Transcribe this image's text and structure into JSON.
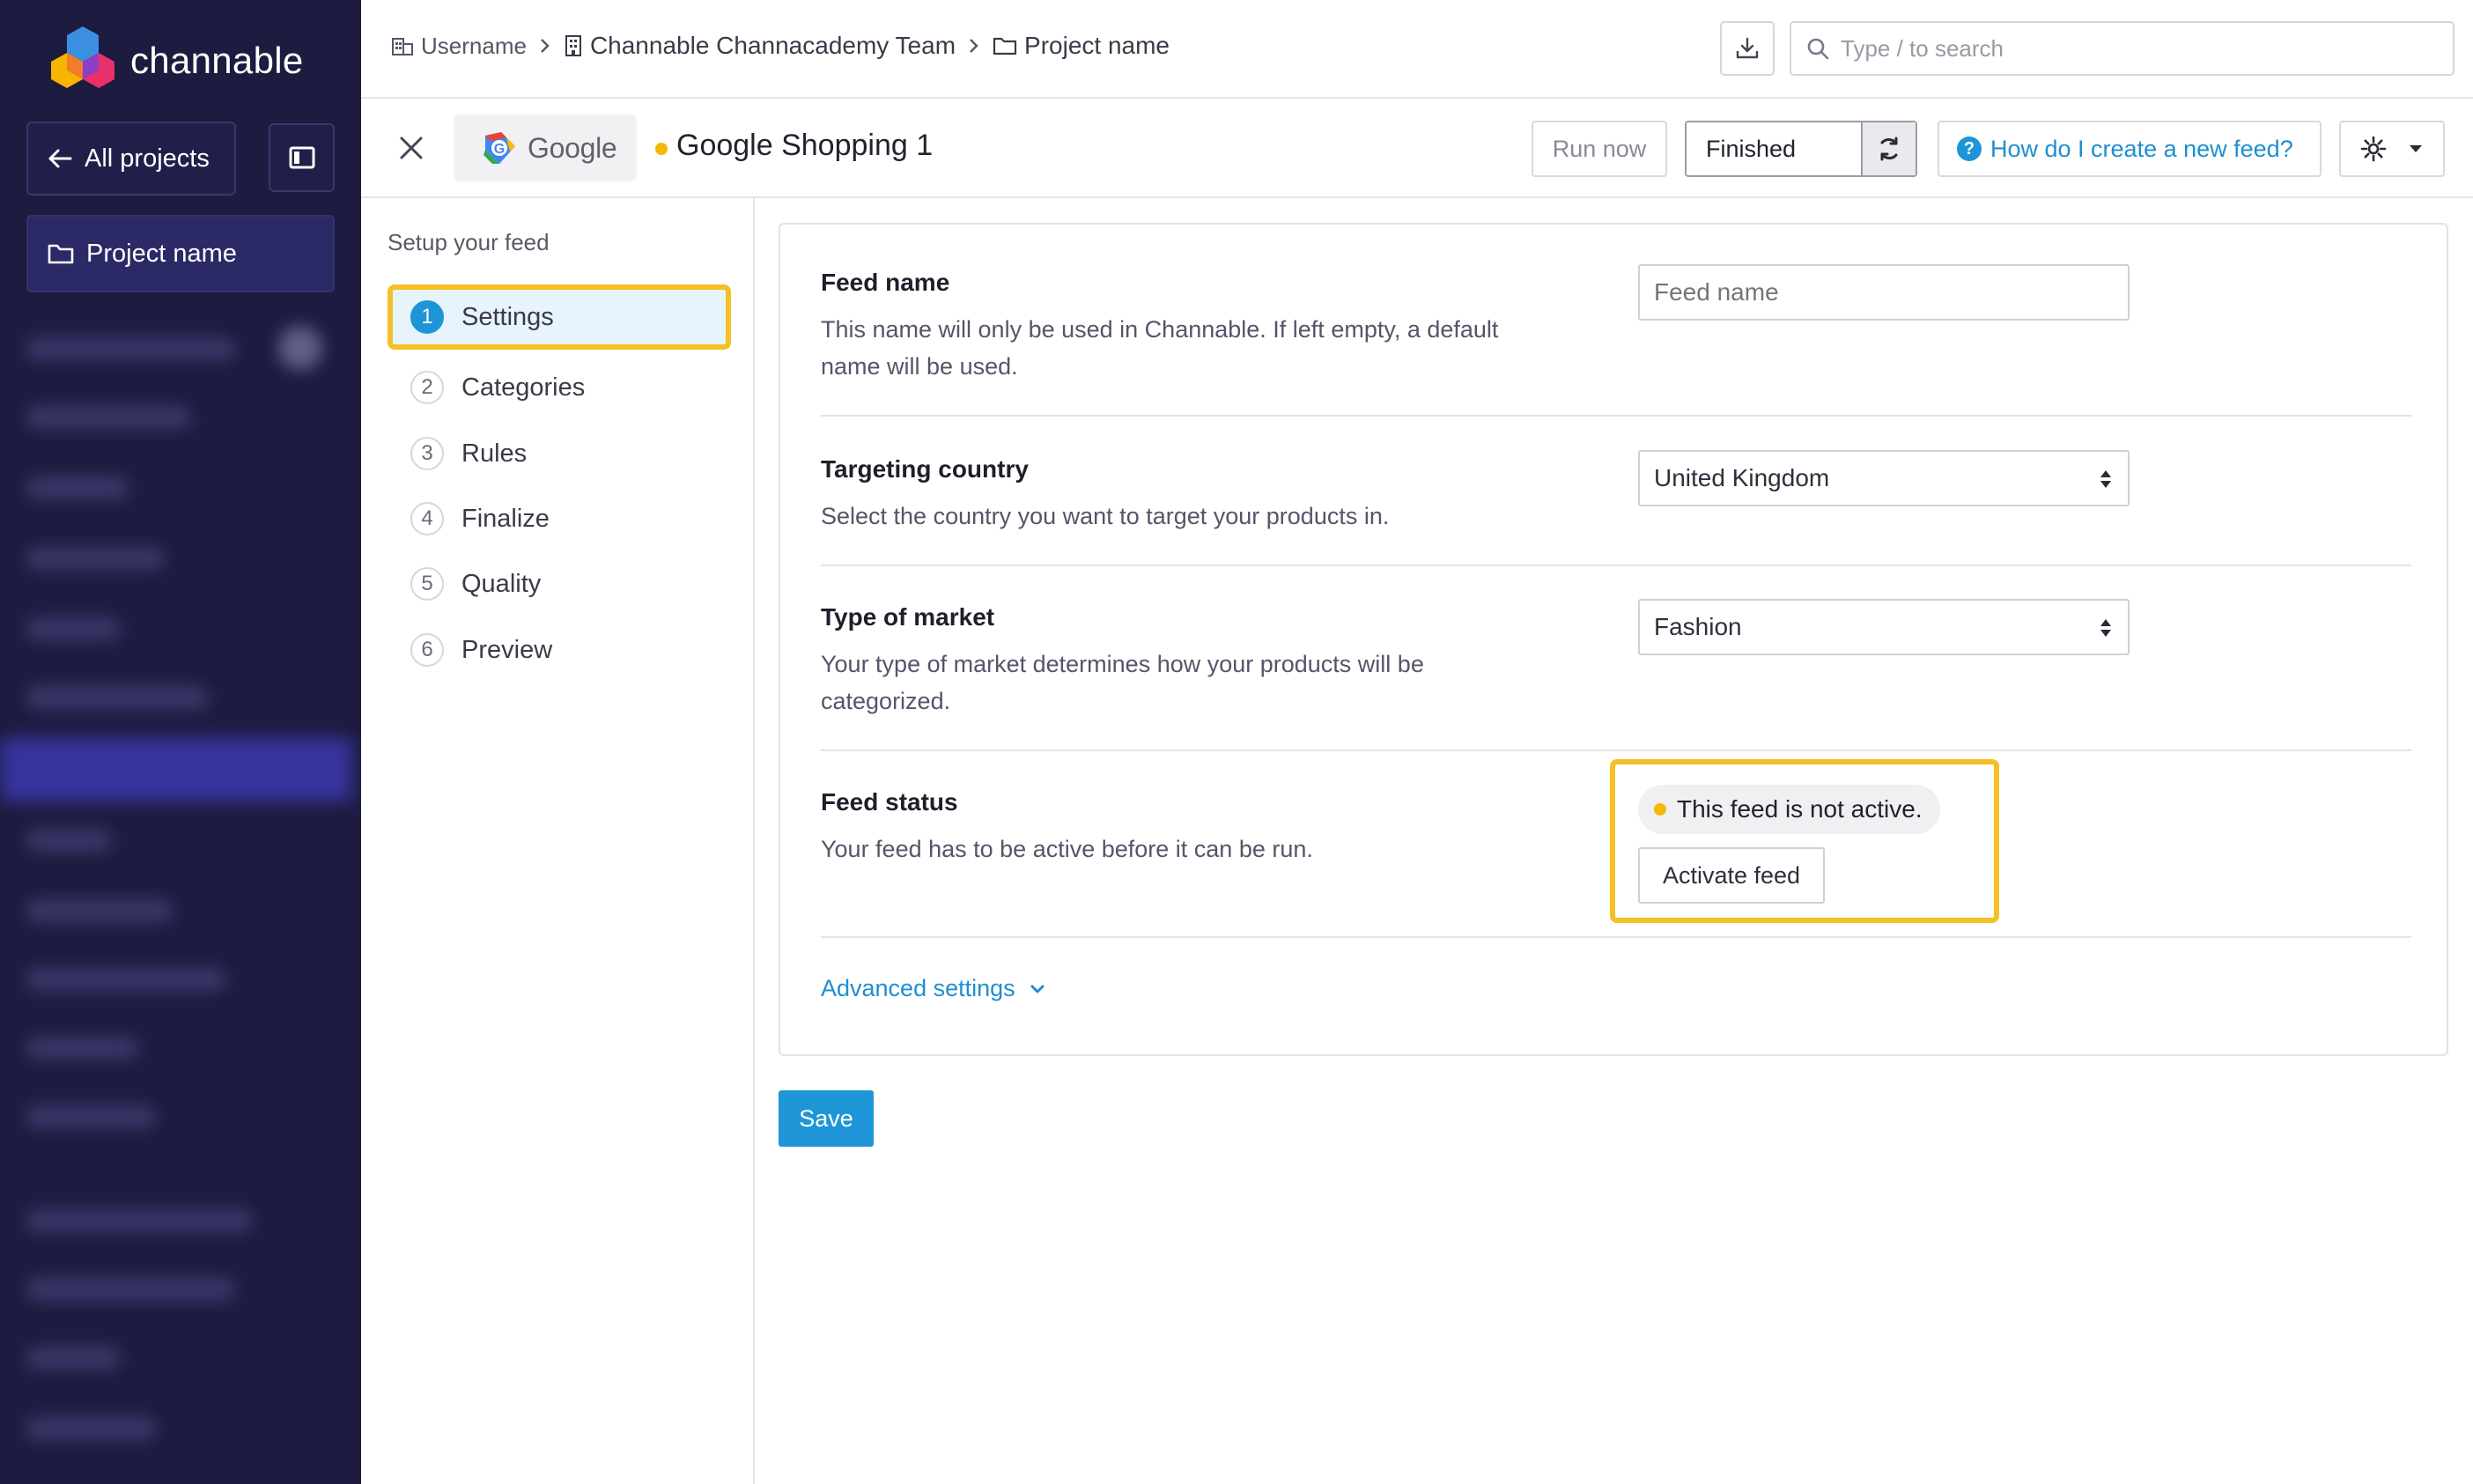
{
  "sidebar": {
    "brand": "channable",
    "all_projects_label": "All projects",
    "project_label": "Project name"
  },
  "breadcrumb": {
    "user": "Username",
    "team": "Channable Channacademy Team",
    "project": "Project name"
  },
  "search": {
    "placeholder": "Type / to search"
  },
  "feed_header": {
    "provider": "Google",
    "feed_title": "Google Shopping 1",
    "run_now_label": "Run now",
    "status_label": "Finished",
    "help_link": "How do I create a new feed?"
  },
  "steps": {
    "heading": "Setup your feed",
    "items": [
      {
        "num": "1",
        "label": "Settings"
      },
      {
        "num": "2",
        "label": "Categories"
      },
      {
        "num": "3",
        "label": "Rules"
      },
      {
        "num": "4",
        "label": "Finalize"
      },
      {
        "num": "5",
        "label": "Quality"
      },
      {
        "num": "6",
        "label": "Preview"
      }
    ],
    "active_index": 0
  },
  "form": {
    "feed_name": {
      "label": "Feed name",
      "description": "This name will only be used in Channable. If left empty, a default name will be used.",
      "placeholder": "Feed name"
    },
    "targeting_country": {
      "label": "Targeting country",
      "description": "Select the country you want to target your products in.",
      "value": "United Kingdom"
    },
    "type_of_market": {
      "label": "Type of market",
      "description": "Your type of market determines how your products will be categorized.",
      "value": "Fashion"
    },
    "feed_status": {
      "label": "Feed status",
      "description": "Your feed has to be active before it can be run.",
      "status_text": "This feed is not active.",
      "activate_label": "Activate feed"
    },
    "advanced_label": "Advanced settings"
  },
  "save_label": "Save",
  "colors": {
    "sidebar_bg": "#1d1b3f",
    "accent_blue": "#1e95d6",
    "highlight_yellow": "#f5bf26",
    "status_dot": "#f5b800"
  }
}
